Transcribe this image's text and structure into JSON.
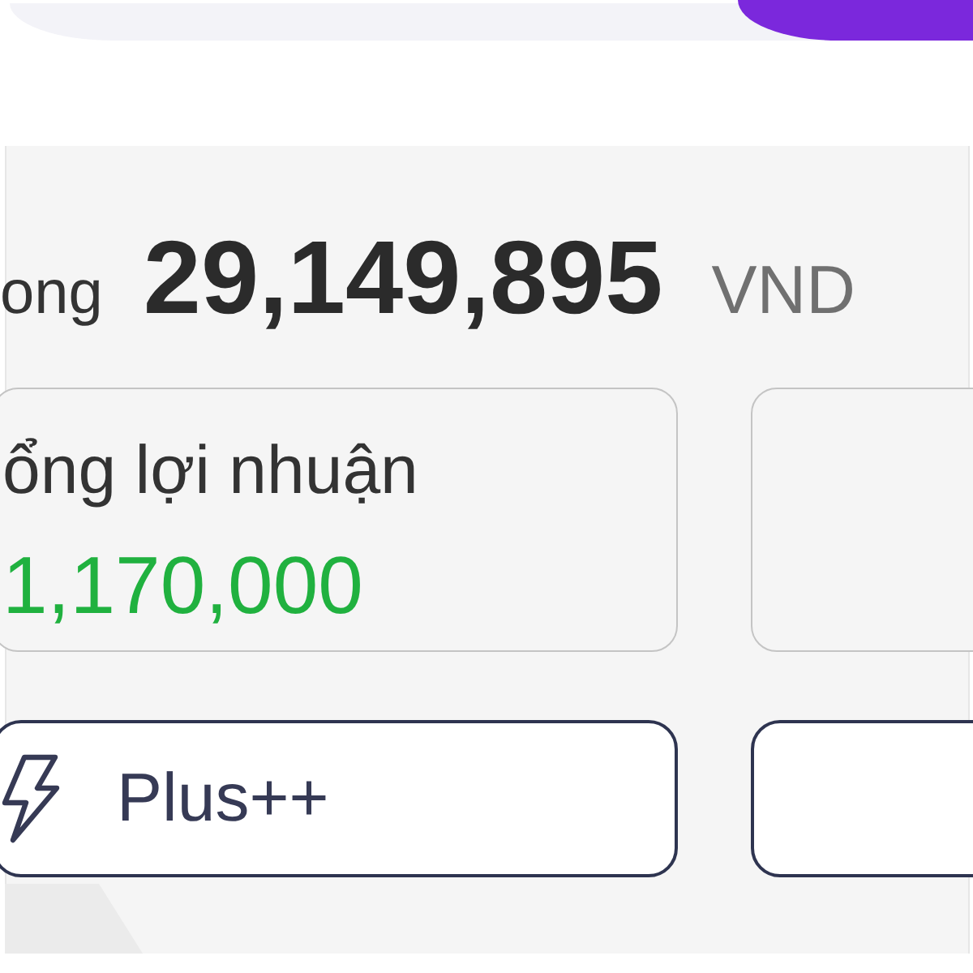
{
  "total": {
    "label": "ong",
    "amount": "29,149,895",
    "currency": "VND"
  },
  "cards": [
    {
      "label": "ổng lợi nhuận",
      "value": "1,170,000",
      "positive": true
    }
  ],
  "buttons": [
    {
      "label": "Plus++"
    }
  ]
}
